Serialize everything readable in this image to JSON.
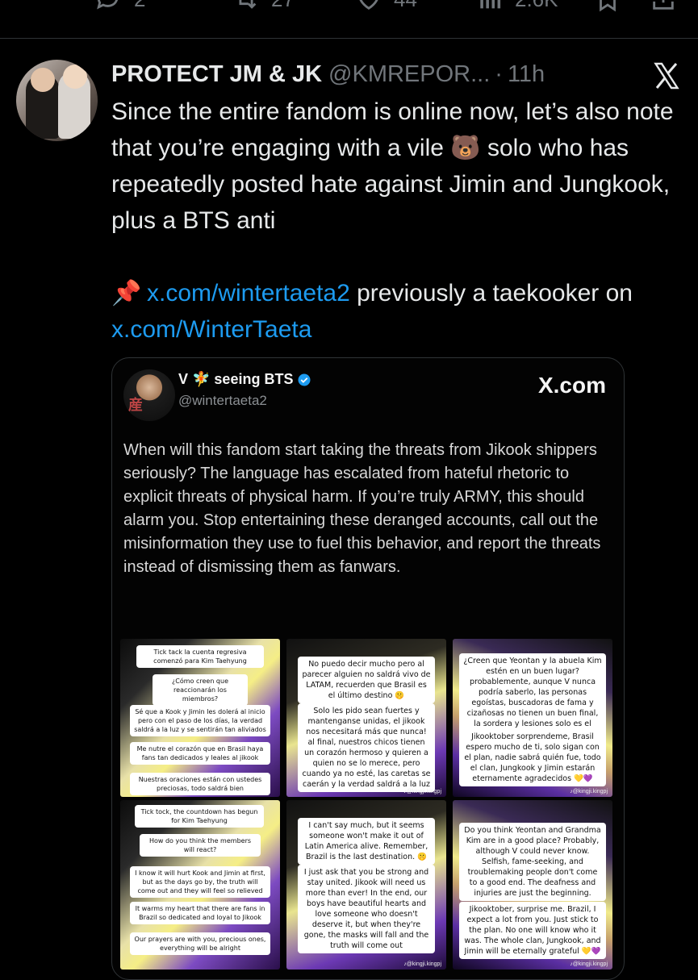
{
  "actions_top": {
    "reply_count": "2",
    "retweet_count": "27",
    "like_count": "44",
    "views_count": "2.6K"
  },
  "tweet": {
    "display_name": "PROTECT JM & JK",
    "handle": "@KMREPOR...",
    "separator": "·",
    "time": "11h",
    "line1": "Since the entire fandom is online now, let’s also note that you’re engaging with a vile 🐻 solo who has repeatedly posted hate against Jimin and Jungkook, plus a BTS anti",
    "pin_emoji": "📌",
    "link1": "x.com/wintertaeta2",
    "mid_text": " previously a taekooker on ",
    "link2": "x.com/WinterTaeta"
  },
  "card": {
    "name": "V 🧚 seeing BTS",
    "handle": "@wintertaeta2",
    "brand": "X.com",
    "text": "When will this fandom start taking the threats from Jikook shippers seriously? The language has escalated from hateful rhetoric to explicit threats of physical harm. If you’re truly ARMY, this should alarm you. Stop entertaining these deranged accounts, call out the misinformation they use to fuel this behavior, and report the threats instead of dismissing them as fanwars.",
    "avatar_text": "産"
  },
  "panels": {
    "p1": [
      "Tick tack la cuenta regresiva comenzó para Kim Taehyung",
      "¿Cómo creen que reaccionarán los miembros?",
      "Sé que a Kook y Jimin les dolerá al inicio pero con el paso de los días, la verdad saldrá a la luz y se sentirán tan aliviados",
      "Me nutre el corazón que en Brasil haya fans tan dedicados y leales al jikook",
      "Nuestras oraciones están con ustedes preciosas, todo saldrá bien"
    ],
    "p2": [
      "No puedo decir mucho pero al parecer alguien no saldrá vivo de LATAM, recuerden que Brasil es el último destino 🤫",
      "Solo les pido sean fuertes y mantenganse unidas, el jikook nos necesitará más que nunca! al final, nuestros chicos tienen un corazón hermoso y quieren a quien no se lo merece, pero cuando ya no esté, las caretas se caerán y la verdad saldrá a la luz"
    ],
    "p3": [
      "¿Creen que Yeontan y la abuela Kim estén en un buen lugar? probablemente, aunque V nunca podría saberlo, las personas egoístas, buscadoras de fama y cizañosas no tienen un buen final, la sordera y lesiones solo es el inicio.",
      "Jikooktober sorprendeme, Brasil espero mucho de ti, solo sigan con el plan, nadie sabrá quién fue, todo el clan, Jungkook y Jimin estarán eternamente agradecidos 💛💜"
    ],
    "p4": [
      "Tick tock, the countdown has begun for Kim Taehyung",
      "How do you think the members will react?",
      "I know it will hurt Kook and Jimin at first, but as the days go by, the truth will come out and they will feel so relieved",
      "It warms my heart that there are fans in Brazil so dedicated and loyal to Jikook",
      "Our prayers are with you, precious ones, everything will be alright"
    ],
    "p5": [
      "I can't say much, but it seems someone won't make it out of Latin America alive. Remember, Brazil is the last destination. 🤫",
      "I just ask that you be strong and stay united. Jikook will need us more than ever! In the end, our boys have beautiful hearts and love someone who doesn't deserve it, but when they're gone, the masks will fall and the truth will come out"
    ],
    "p6": [
      "Do you think Yeontan and Grandma Kim are in a good place? Probably, although V could never know. Selfish, fame-seeking, and troublemaking people don't come to a good end. The deafness and injuries are just the beginning.",
      "Jikooktober, surprise me. Brazil, I expect a lot from you. Just stick to the plan. No one will know who it was. The whole clan, Jungkook, and Jimin will be eternally grateful 💛💜"
    ],
    "watermark": "♪@kingji.kingpj"
  },
  "colors": {
    "background": "#000000",
    "text": "#e7e9ea",
    "muted": "#71767b",
    "link": "#1d9bf0",
    "border": "#2f3336"
  }
}
